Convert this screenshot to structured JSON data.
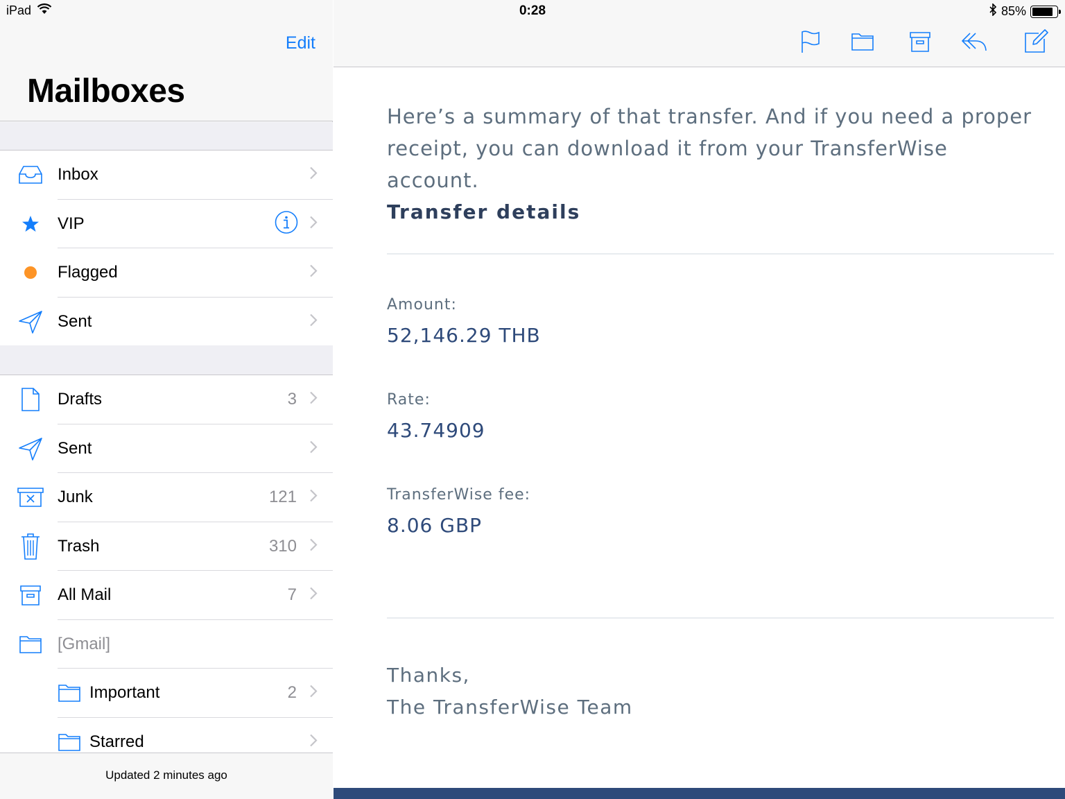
{
  "status_bar": {
    "device": "iPad",
    "time": "0:28",
    "battery_percent": "85%",
    "battery_level": 0.85
  },
  "sidebar": {
    "edit_label": "Edit",
    "title": "Mailboxes",
    "favorites": [
      {
        "label": "Inbox",
        "icon": "inbox-icon"
      },
      {
        "label": "VIP",
        "icon": "star-icon"
      },
      {
        "label": "Flagged",
        "icon": "orange-dot-icon"
      },
      {
        "label": "Sent",
        "icon": "paper-plane-icon"
      }
    ],
    "accounts": [
      {
        "label": "Drafts",
        "count": "3",
        "icon": "document-icon"
      },
      {
        "label": "Sent",
        "count": "",
        "icon": "paper-plane-icon"
      },
      {
        "label": "Junk",
        "count": "121",
        "icon": "junk-box-icon"
      },
      {
        "label": "Trash",
        "count": "310",
        "icon": "trash-icon"
      },
      {
        "label": "All Mail",
        "count": "7",
        "icon": "archive-box-icon"
      },
      {
        "label": "[Gmail]",
        "count": "",
        "icon": "folder-icon"
      },
      {
        "label": "Important",
        "count": "2",
        "icon": "folder-icon"
      },
      {
        "label": "Starred",
        "count": "",
        "icon": "folder-icon"
      }
    ],
    "footer": "Updated 2 minutes ago"
  },
  "toolbar": {
    "icons": [
      "flag-icon",
      "folder-icon",
      "archive-icon",
      "reply-icon",
      "compose-icon"
    ]
  },
  "email": {
    "intro": "Here’s a summary of that transfer. And if you need a proper receipt, you can download it from your TransferWise account.",
    "details_heading": "Transfer details",
    "amount_label": "Amount:",
    "amount_value": "52,146.29 THB",
    "rate_label": "Rate:",
    "rate_value": "43.74909",
    "fee_label": "TransferWise fee:",
    "fee_value": "8.06 GBP",
    "thanks": "Thanks,",
    "team": "The TransferWise Team"
  },
  "colors": {
    "ios_blue": "#147efb",
    "flag_orange": "#fd9426",
    "brand_navy": "#2e4a7a",
    "text_gray": "#5d6e7e"
  }
}
